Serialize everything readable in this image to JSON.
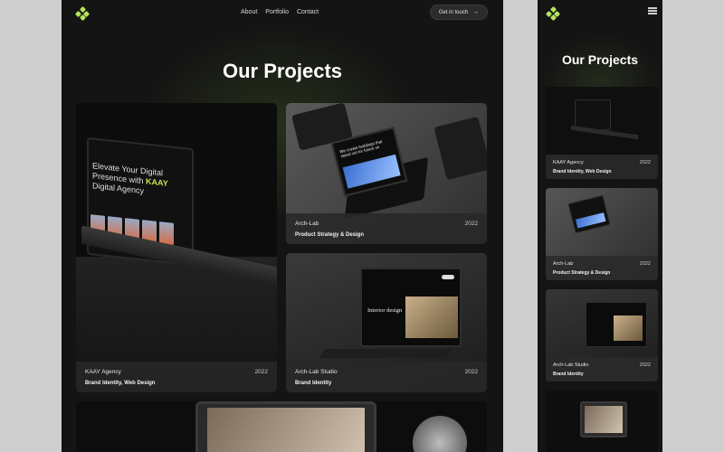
{
  "desktop": {
    "nav": {
      "links": [
        "About",
        "Portfolio",
        "Contact"
      ],
      "cta_label": "Get in touch",
      "cta_arrow": "→"
    },
    "title": "Our Projects",
    "projects": [
      {
        "name": "KAAY Agency",
        "year": "2022",
        "tags": "Brand Identity, Web Design",
        "screen_text_a": "Elevate Your Digital Presence with",
        "screen_text_b": "KAAY",
        "screen_text_c": "Digital Agency"
      },
      {
        "name": "Arch-Lab",
        "year": "2022",
        "tags": "Product Strategy & Design",
        "screen_text": "We create buildings that stand out for future us"
      },
      {
        "name": "Arch-Lab Studio",
        "year": "2022",
        "tags": "Brand Identity",
        "screen_text": "Interior design"
      }
    ]
  },
  "mobile": {
    "title": "Our Projects",
    "projects": [
      {
        "name": "KAAY Agency",
        "year": "2022",
        "tags": "Brand Identity, Web Design"
      },
      {
        "name": "Arch-Lab",
        "year": "2022",
        "tags": "Product Strategy & Design"
      },
      {
        "name": "Arch-Lab Studio",
        "year": "2022",
        "tags": "Brand Identity"
      }
    ]
  },
  "colors": {
    "accent": "#b6e35a",
    "background": "#141414",
    "page_outer": "#cfcfcf"
  },
  "icons": {
    "logo": "diamond-cluster-logo",
    "cta_arrow": "arrow-right-icon",
    "menu": "hamburger-menu-icon"
  }
}
